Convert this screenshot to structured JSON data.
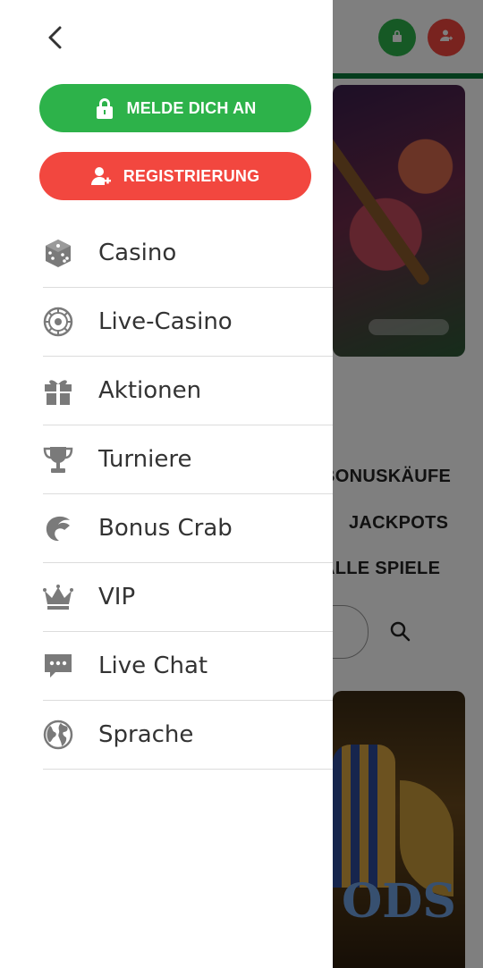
{
  "colors": {
    "green": "#2db24a",
    "red": "#f2473f",
    "icon_gray": "#7a7a7a",
    "text": "#333333"
  },
  "header": {
    "login_icon": "lock-icon",
    "register_icon": "user-plus-icon"
  },
  "background": {
    "categories": [
      "BONUSKÄUFE",
      "JACKPOTS",
      "ALLE SPIELE"
    ],
    "card_title": "ODS"
  },
  "drawer": {
    "back_icon": "chevron-left-icon",
    "login_label": "MELDE DICH AN",
    "register_label": "REGISTRIERUNG",
    "menu": [
      {
        "label": "Casino",
        "icon": "dice-icon"
      },
      {
        "label": "Live-Casino",
        "icon": "roulette-icon"
      },
      {
        "label": "Aktionen",
        "icon": "gift-icon"
      },
      {
        "label": "Turniere",
        "icon": "trophy-icon"
      },
      {
        "label": "Bonus Crab",
        "icon": "crab-claw-icon"
      },
      {
        "label": "VIP",
        "icon": "crown-icon"
      },
      {
        "label": "Live Chat",
        "icon": "chat-icon"
      },
      {
        "label": "Sprache",
        "icon": "globe-icon"
      }
    ]
  }
}
